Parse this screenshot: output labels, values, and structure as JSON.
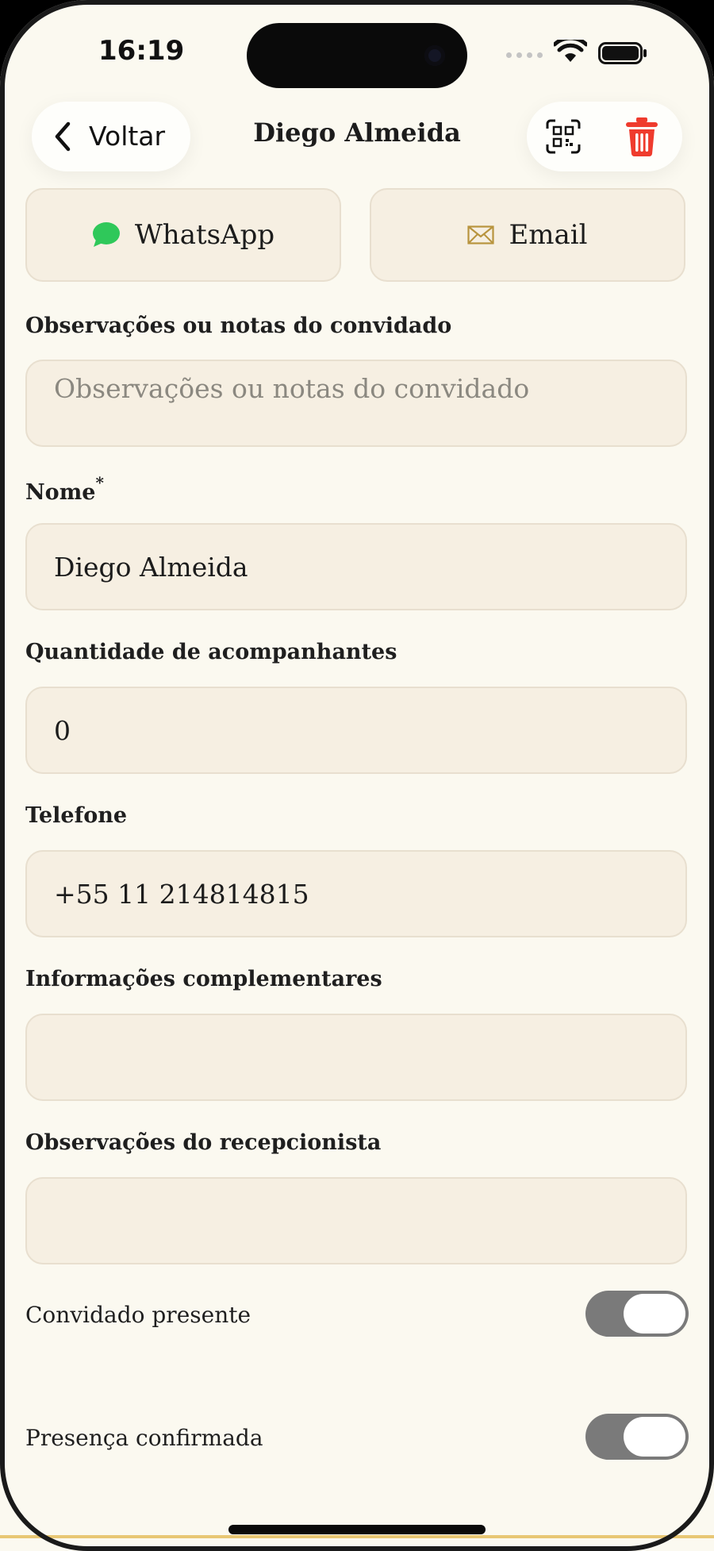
{
  "status_bar": {
    "time": "16:19"
  },
  "nav": {
    "back_label": "Voltar",
    "title": "Diego Almeida",
    "icons": {
      "back": "chevron-left-icon",
      "qr": "qr-code-icon",
      "delete": "trash-icon"
    },
    "delete_color": "#ef3b2d"
  },
  "contact": {
    "whatsapp_label": "WhatsApp",
    "email_label": "Email",
    "whatsapp_color": "#2fc85a",
    "email_color": "#b8943e"
  },
  "form": {
    "notes": {
      "label": "Observações ou notas do convidado",
      "placeholder": "Observações ou notas do convidado",
      "value": ""
    },
    "name": {
      "label": "Nome",
      "required_mark": "*",
      "value": "Diego Almeida"
    },
    "companions": {
      "label": "Quantidade de acompanhantes",
      "value": "0"
    },
    "phone": {
      "label": "Telefone",
      "value": "+55 11 214814815"
    },
    "extra_info": {
      "label": "Informações complementares",
      "value": ""
    },
    "receptionist_notes": {
      "label": "Observações do recepcionista",
      "value": ""
    }
  },
  "toggles": {
    "present": {
      "label": "Convidado presente",
      "on": false
    },
    "confirmed": {
      "label": "Presença confirmada",
      "on": false
    }
  },
  "colors": {
    "background": "#fbf9f0",
    "field_background": "#f6efe2",
    "toggle_track": "#7a7a7a",
    "accent_line": "#e8c774"
  }
}
